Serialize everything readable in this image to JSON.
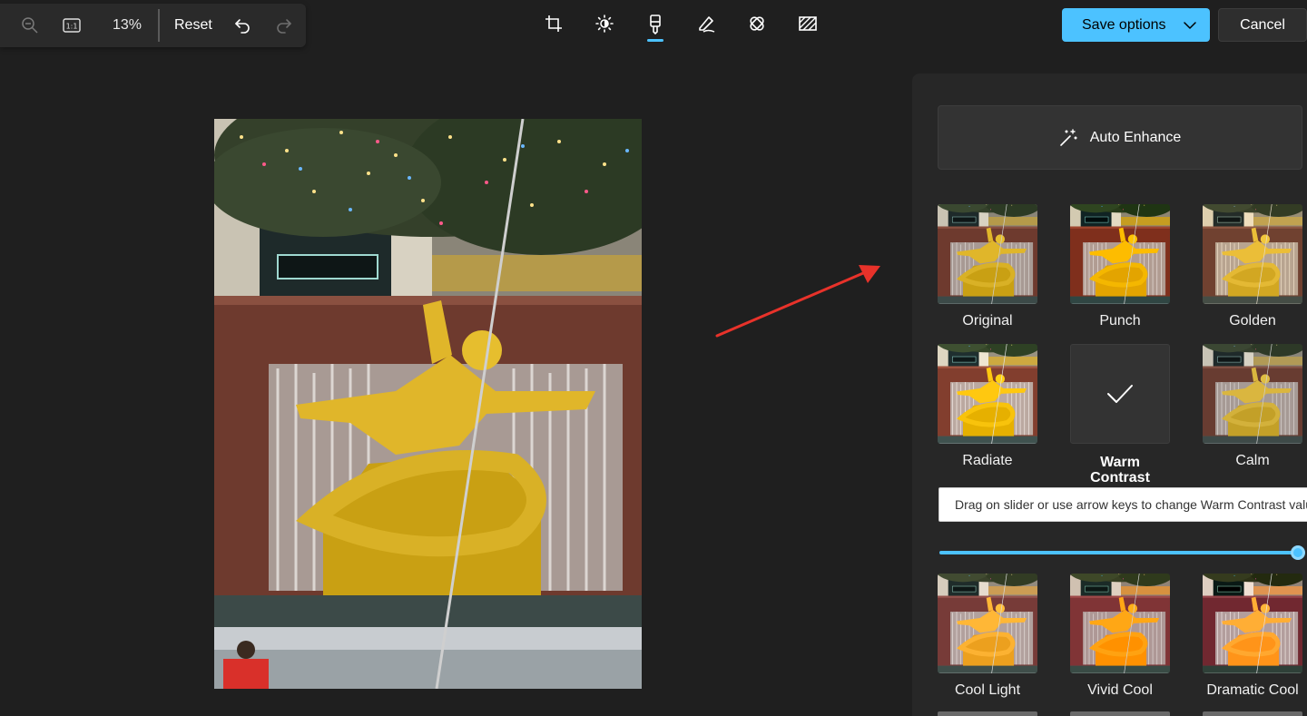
{
  "toolbar": {
    "zoom_value": "13%",
    "reset_label": "Reset",
    "icons": [
      "zoom-out-icon",
      "actual-size-icon",
      "undo-icon",
      "redo-icon"
    ]
  },
  "tools": [
    {
      "name": "crop-icon",
      "active": false
    },
    {
      "name": "adjustment-icon",
      "active": false
    },
    {
      "name": "filter-icon",
      "active": true
    },
    {
      "name": "markup-icon",
      "active": false
    },
    {
      "name": "retouch-icon",
      "active": false
    },
    {
      "name": "background-icon",
      "active": false
    }
  ],
  "actions": {
    "save_label": "Save options",
    "cancel_label": "Cancel"
  },
  "panel": {
    "auto_enhance_label": "Auto Enhance",
    "filters": [
      {
        "label": "Original"
      },
      {
        "label": "Punch"
      },
      {
        "label": "Golden"
      },
      {
        "label": "Radiate"
      },
      {
        "label_line1": "Warm",
        "label_line2": "Contrast",
        "selected": true
      },
      {
        "label": "Calm"
      },
      {
        "label": "Cool Light"
      },
      {
        "label": "Vivid Cool"
      },
      {
        "label": "Dramatic Cool"
      }
    ],
    "tooltip": "Drag on slider or use arrow keys to change Warm Contrast valu",
    "slider_value": 1.0
  },
  "colors": {
    "accent": "#4cc2ff",
    "background": "#1f1f1f",
    "panel": "#272727",
    "annotation_arrow": "#e8322a"
  }
}
